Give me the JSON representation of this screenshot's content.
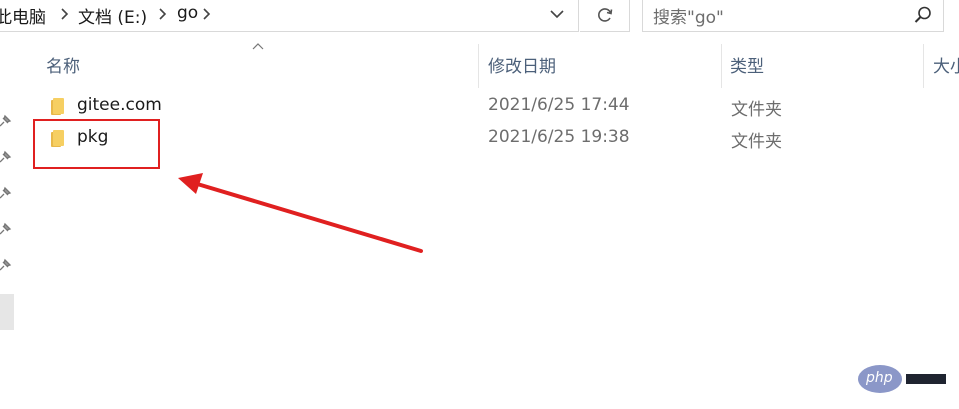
{
  "address_bar": {
    "breadcrumbs": [
      "此电脑",
      "文档 (E:)",
      "go"
    ],
    "dropdown_icon": "chevron-down-icon",
    "refresh_icon": "refresh-icon"
  },
  "search": {
    "placeholder": "搜索\"go\"",
    "icon": "search-icon"
  },
  "columns": {
    "name": "名称",
    "date": "修改日期",
    "type": "类型",
    "size": "大小"
  },
  "files": [
    {
      "name": "gitee.com",
      "date": "2021/6/25 17:44",
      "type": "文件夹"
    },
    {
      "name": "pkg",
      "date": "2021/6/25 19:38",
      "type": "文件夹"
    }
  ],
  "annotation": {
    "highlight_color": "#e02020",
    "arrow_color": "#e02020"
  },
  "watermark": {
    "text": "php"
  }
}
